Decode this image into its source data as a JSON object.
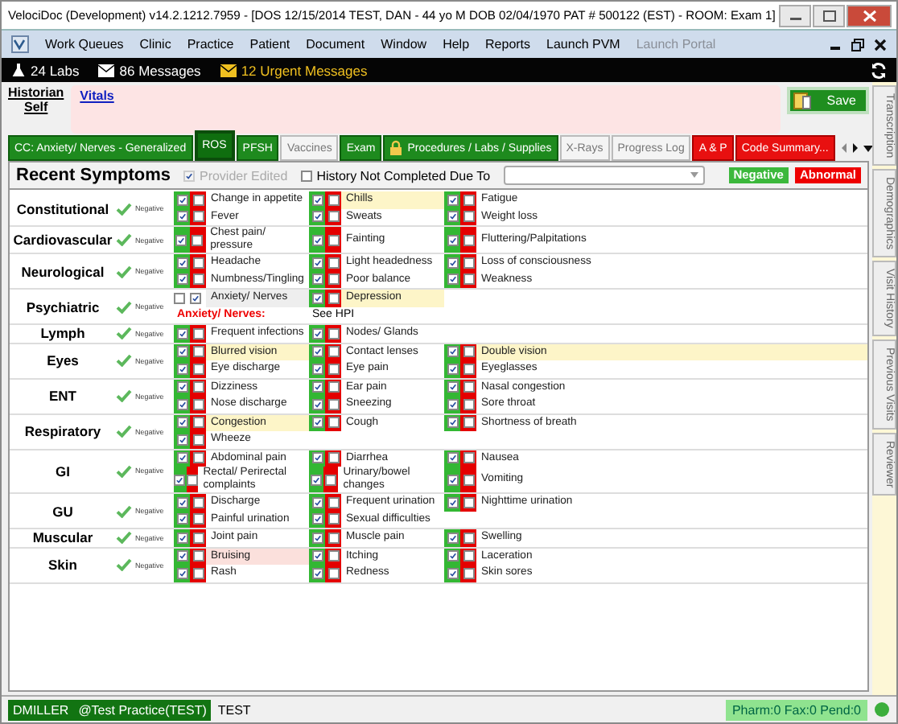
{
  "window": {
    "title": "VelociDoc (Development) v14.2.1212.7959 - [DOS 12/15/2014 TEST, DAN - 44 yo M DOB 02/04/1970 PAT # 500122 (EST) - ROOM: Exam 1]"
  },
  "menu": [
    {
      "label": "Work Queues",
      "disabled": false
    },
    {
      "label": "Clinic",
      "disabled": false
    },
    {
      "label": "Practice",
      "disabled": false
    },
    {
      "label": "Patient",
      "disabled": false
    },
    {
      "label": "Document",
      "disabled": false
    },
    {
      "label": "Window",
      "disabled": false
    },
    {
      "label": "Help",
      "disabled": false
    },
    {
      "label": "Reports",
      "disabled": false
    },
    {
      "label": "Launch PVM",
      "disabled": false
    },
    {
      "label": "Launch Portal",
      "disabled": true
    }
  ],
  "alerts": [
    {
      "kind": "labs",
      "text": "24 Labs"
    },
    {
      "kind": "messages",
      "text": "86 Messages"
    },
    {
      "kind": "urgent",
      "text": "12 Urgent Messages"
    }
  ],
  "historian": {
    "label": "Historian",
    "value": "Self"
  },
  "vitals_link": "Vitals",
  "save_button": "Save",
  "tabs": [
    {
      "label": "CC: Anxiety/ Nerves - Generalized",
      "kind": "done",
      "locked": false,
      "selected": false
    },
    {
      "label": "ROS",
      "kind": "done",
      "locked": false,
      "selected": true
    },
    {
      "label": "PFSH",
      "kind": "done",
      "locked": false,
      "selected": false
    },
    {
      "label": "Vaccines",
      "kind": "none",
      "locked": false,
      "selected": false
    },
    {
      "label": "Exam",
      "kind": "done",
      "locked": false,
      "selected": false
    },
    {
      "label": "Procedures / Labs / Supplies",
      "kind": "done",
      "locked": true,
      "selected": false
    },
    {
      "label": "X-Rays",
      "kind": "none",
      "locked": false,
      "selected": false
    },
    {
      "label": "Progress Log",
      "kind": "none",
      "locked": false,
      "selected": false
    },
    {
      "label": "A & P",
      "kind": "alert",
      "locked": false,
      "selected": false
    },
    {
      "label": "Code Summary...",
      "kind": "alert",
      "locked": false,
      "selected": false
    }
  ],
  "side_tabs": [
    "Transcription",
    "Demographics",
    "Visit History",
    "Previous Visits",
    "Reviewer"
  ],
  "section": {
    "title": "Recent Symptoms",
    "provider_edited": {
      "label": "Provider Edited",
      "checked": true,
      "disabled": true
    },
    "history_incomplete": {
      "label": "History Not Completed Due To",
      "checked": false
    },
    "legend": [
      {
        "kind": "negative",
        "text": "Negative"
      },
      {
        "kind": "abnormal",
        "text": "Abnormal"
      }
    ]
  },
  "systems": [
    {
      "name": "Constitutional",
      "negative_label": "Negative",
      "rows": [
        [
          {
            "kind": "pair",
            "label": "Change in appetite",
            "negative": true,
            "abnormal": false
          },
          {
            "kind": "pair",
            "label": "Chills",
            "negative": true,
            "abnormal": false,
            "color": "#fdf5c8"
          },
          {
            "kind": "pair",
            "label": "Fatigue",
            "negative": true,
            "abnormal": false
          }
        ],
        [
          {
            "kind": "pair",
            "label": "Fever",
            "negative": true,
            "abnormal": false
          },
          {
            "kind": "pair",
            "label": "Sweats",
            "negative": true,
            "abnormal": false
          },
          {
            "kind": "pair",
            "label": "Weight loss",
            "negative": true,
            "abnormal": false
          }
        ]
      ]
    },
    {
      "name": "Cardiovascular",
      "negative_label": "Negative",
      "rows": [
        [
          {
            "kind": "pair",
            "label": "Chest pain/ pressure",
            "negative": true,
            "abnormal": false
          },
          {
            "kind": "pair",
            "label": "Fainting",
            "negative": true,
            "abnormal": false
          },
          {
            "kind": "pair",
            "label": "Fluttering/Palpitations",
            "negative": true,
            "abnormal": false
          }
        ]
      ]
    },
    {
      "name": "Neurological",
      "negative_label": "Negative",
      "rows": [
        [
          {
            "kind": "pair",
            "label": "Headache",
            "negative": true,
            "abnormal": false
          },
          {
            "kind": "pair",
            "label": "Light headedness",
            "negative": true,
            "abnormal": false
          },
          {
            "kind": "pair",
            "label": "Loss of consciousness",
            "negative": true,
            "abnormal": false
          }
        ],
        [
          {
            "kind": "pair",
            "label": "Numbness/Tingling",
            "negative": true,
            "abnormal": false
          },
          {
            "kind": "pair",
            "label": "Poor balance",
            "negative": true,
            "abnormal": false
          },
          {
            "kind": "pair",
            "label": "Weakness",
            "negative": true,
            "abnormal": false
          }
        ]
      ]
    },
    {
      "name": "Psychiatric",
      "negative_label": "Negative",
      "rows": [
        [
          {
            "kind": "plain",
            "label": "Anxiety/ Nerves",
            "checks": [
              false,
              true
            ]
          },
          {
            "kind": "pair",
            "label": "Depression",
            "negative": true,
            "abnormal": false,
            "color": "#fdf5c8"
          }
        ]
      ],
      "notes": [
        {
          "kind": "alert",
          "text": "Anxiety/ Nerves:"
        },
        {
          "kind": "plain",
          "text": "See HPI"
        }
      ]
    },
    {
      "name": "Lymph",
      "negative_label": "Negative",
      "rows": [
        [
          {
            "kind": "pair",
            "label": "Frequent infections",
            "negative": true,
            "abnormal": false
          },
          {
            "kind": "pair",
            "label": "Nodes/ Glands",
            "negative": true,
            "abnormal": false
          }
        ]
      ]
    },
    {
      "name": "Eyes",
      "negative_label": "Negative",
      "rows": [
        [
          {
            "kind": "pair",
            "label": "Blurred vision",
            "negative": true,
            "abnormal": false,
            "color": "#fdf5c8"
          },
          {
            "kind": "pair",
            "label": "Contact lenses",
            "negative": true,
            "abnormal": false
          },
          {
            "kind": "pair",
            "label": "Double vision",
            "negative": true,
            "abnormal": false,
            "color": "#fdf5c8"
          }
        ],
        [
          {
            "kind": "pair",
            "label": "Eye discharge",
            "negative": true,
            "abnormal": false
          },
          {
            "kind": "pair",
            "label": "Eye pain",
            "negative": true,
            "abnormal": false
          },
          {
            "kind": "pair",
            "label": "Eyeglasses",
            "negative": true,
            "abnormal": false
          }
        ]
      ]
    },
    {
      "name": "ENT",
      "negative_label": "Negative",
      "rows": [
        [
          {
            "kind": "pair",
            "label": "Dizziness",
            "negative": true,
            "abnormal": false
          },
          {
            "kind": "pair",
            "label": "Ear pain",
            "negative": true,
            "abnormal": false
          },
          {
            "kind": "pair",
            "label": "Nasal congestion",
            "negative": true,
            "abnormal": false
          }
        ],
        [
          {
            "kind": "pair",
            "label": "Nose discharge",
            "negative": true,
            "abnormal": false
          },
          {
            "kind": "pair",
            "label": "Sneezing",
            "negative": true,
            "abnormal": false
          },
          {
            "kind": "pair",
            "label": "Sore throat",
            "negative": true,
            "abnormal": false
          }
        ]
      ]
    },
    {
      "name": "Respiratory",
      "negative_label": "Negative",
      "rows": [
        [
          {
            "kind": "pair",
            "label": "Congestion",
            "negative": true,
            "abnormal": false,
            "color": "#fdf5c8"
          },
          {
            "kind": "pair",
            "label": "Cough",
            "negative": true,
            "abnormal": false
          },
          {
            "kind": "pair",
            "label": "Shortness of breath",
            "negative": true,
            "abnormal": false
          }
        ],
        [
          {
            "kind": "pair",
            "label": "Wheeze",
            "negative": true,
            "abnormal": false
          }
        ]
      ]
    },
    {
      "name": "GI",
      "negative_label": "Negative",
      "rows": [
        [
          {
            "kind": "pair",
            "label": "Abdominal pain",
            "negative": true,
            "abnormal": false
          },
          {
            "kind": "pair",
            "label": "Diarrhea",
            "negative": true,
            "abnormal": false
          },
          {
            "kind": "pair",
            "label": "Nausea",
            "negative": true,
            "abnormal": false
          }
        ],
        [
          {
            "kind": "pair",
            "label": "Rectal/ Perirectal complaints",
            "negative": true,
            "abnormal": false
          },
          {
            "kind": "pair",
            "label": "Urinary/bowel changes",
            "negative": true,
            "abnormal": false
          },
          {
            "kind": "pair",
            "label": "Vomiting",
            "negative": true,
            "abnormal": false
          }
        ]
      ]
    },
    {
      "name": "GU",
      "negative_label": "Negative",
      "rows": [
        [
          {
            "kind": "pair",
            "label": "Discharge",
            "negative": true,
            "abnormal": false
          },
          {
            "kind": "pair",
            "label": "Frequent urination",
            "negative": true,
            "abnormal": false
          },
          {
            "kind": "pair",
            "label": "Nighttime urination",
            "negative": true,
            "abnormal": false
          }
        ],
        [
          {
            "kind": "pair",
            "label": "Painful urination",
            "negative": true,
            "abnormal": false
          },
          {
            "kind": "pair",
            "label": "Sexual difficulties",
            "negative": true,
            "abnormal": false
          }
        ]
      ]
    },
    {
      "name": "Muscular",
      "negative_label": "Negative",
      "rows": [
        [
          {
            "kind": "pair",
            "label": "Joint pain",
            "negative": true,
            "abnormal": false
          },
          {
            "kind": "pair",
            "label": "Muscle pain",
            "negative": true,
            "abnormal": false
          },
          {
            "kind": "pair",
            "label": "Swelling",
            "negative": true,
            "abnormal": false
          }
        ]
      ]
    },
    {
      "name": "Skin",
      "negative_label": "Negative",
      "rows": [
        [
          {
            "kind": "pair",
            "label": "Bruising",
            "negative": true,
            "abnormal": false,
            "color": "#fbe0dc"
          },
          {
            "kind": "pair",
            "label": "Itching",
            "negative": true,
            "abnormal": false
          },
          {
            "kind": "pair",
            "label": "Laceration",
            "negative": true,
            "abnormal": false
          }
        ],
        [
          {
            "kind": "pair",
            "label": "Rash",
            "negative": true,
            "abnormal": false
          },
          {
            "kind": "pair",
            "label": "Redness",
            "negative": true,
            "abnormal": false
          },
          {
            "kind": "pair",
            "label": "Skin sores",
            "negative": true,
            "abnormal": false
          }
        ]
      ]
    }
  ],
  "status_bar": {
    "user": "DMILLER",
    "practice": "@Test Practice(TEST)",
    "site": "TEST",
    "counts": "Pharm:0 Fax:0 Pend:0"
  }
}
